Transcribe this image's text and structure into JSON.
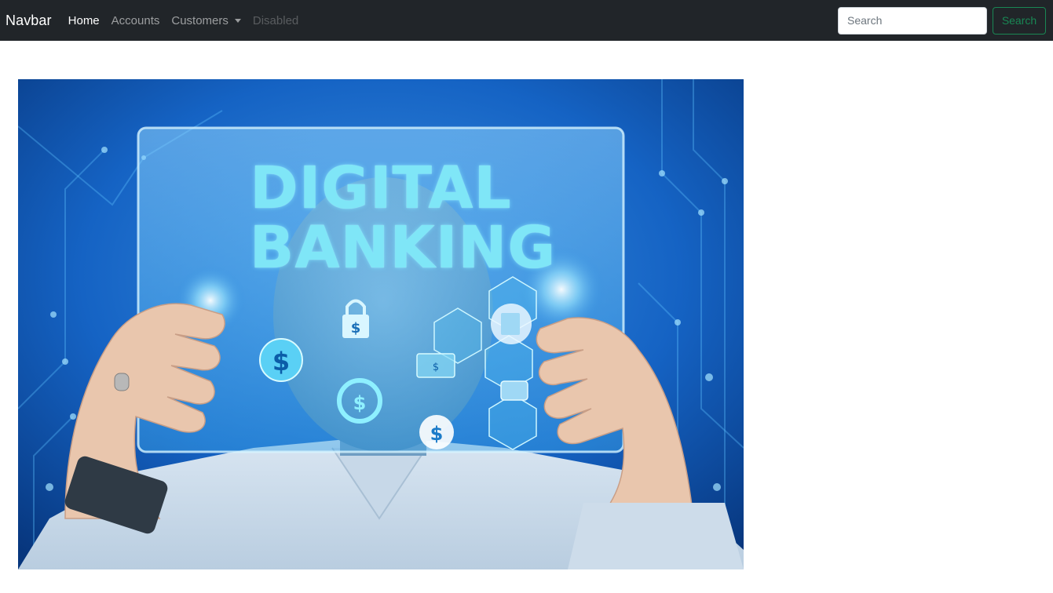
{
  "navbar": {
    "brand": "Navbar",
    "items": [
      {
        "label": "Home",
        "state": "active"
      },
      {
        "label": "Accounts",
        "state": "normal"
      },
      {
        "label": "Customers",
        "state": "dropdown"
      },
      {
        "label": "Disabled",
        "state": "disabled"
      }
    ],
    "search": {
      "placeholder": "Search",
      "button_label": "Search"
    }
  },
  "hero": {
    "title_line1": "DIGITAL",
    "title_line2": "BANKING",
    "icons": [
      "padlock-dollar-icon",
      "dollar-coin-icon",
      "refresh-dollar-icon",
      "card-icon",
      "document-icon",
      "wallet-icon"
    ]
  },
  "colors": {
    "navbar_bg": "#212529",
    "search_button": "#198754",
    "hero_text": "#7fe6f7"
  }
}
